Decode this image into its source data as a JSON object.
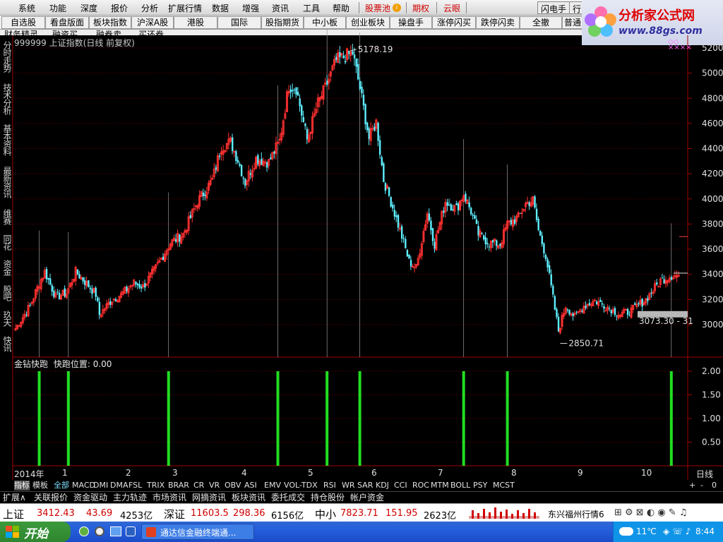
{
  "menu": {
    "items": [
      "系统",
      "功能",
      "深度",
      "报价",
      "分析",
      "扩展行情",
      "数据",
      "增强",
      "资讯",
      "工具",
      "帮助"
    ],
    "red_items": [
      "股票池",
      "期权",
      "云眼"
    ],
    "right_buttons": [
      "闪电手",
      "行"
    ]
  },
  "logo": {
    "title": "分析家公式网",
    "url": "www.88gs.com"
  },
  "toolbar": {
    "row1": [
      "自选股",
      "看盘版面",
      "板块指数",
      "沪深A股",
      "港股",
      "国际",
      "股指期货",
      "中小板",
      "创业板块",
      "操盘手",
      "涨停闪买",
      "跌停闪卖",
      "全撤",
      "普通"
    ],
    "row2": [
      "财务精灵",
      "融资买",
      "融券卖",
      "买还券"
    ]
  },
  "sidebar": {
    "tabs": [
      "分时走势",
      "技术分析",
      "基本资料",
      "最新资讯",
      "维赛",
      "同花",
      "资金",
      "股吧",
      "玖天",
      "快讯"
    ]
  },
  "chart": {
    "code": "999999",
    "name": "上证指数",
    "period": "(日线 前复权)",
    "high_label": "5178.19",
    "low_label": "2850.71",
    "last_label": "3073.30 - 31",
    "y_ticks": [
      "5200",
      "5000",
      "4800",
      "4600",
      "4400",
      "4200",
      "4000",
      "3800",
      "3600",
      "3400",
      "3200",
      "3000"
    ]
  },
  "indicator": {
    "title": "金钻快跑",
    "param_label": "快跑位置: 0.00",
    "y_ticks": [
      "2.00",
      "1.50",
      "1.00",
      "0.50"
    ],
    "colors": {
      "signal": "#22dd22"
    }
  },
  "chart_data": {
    "type": "candlestick",
    "series_name": "上证指数",
    "period": "daily",
    "x_range": [
      "2014-12",
      "2015-10"
    ],
    "ylim": [
      2800,
      5250
    ],
    "x_labels": [
      "2014年",
      "1",
      "2",
      "3",
      "4",
      "5",
      "6",
      "7",
      "8",
      "9",
      "10"
    ],
    "x_label_right": "日线",
    "colors": {
      "up": "#ff3030",
      "down": "#5ff0ff",
      "grid": "#7a0000"
    },
    "key_values": {
      "high": 5178.19,
      "low": 2850.71,
      "last": 3073.3
    },
    "price_path": [
      [
        0,
        2970
      ],
      [
        4,
        3060
      ],
      [
        8,
        3150
      ],
      [
        13,
        3330
      ],
      [
        16,
        3420
      ],
      [
        22,
        3220
      ],
      [
        28,
        3250
      ],
      [
        33,
        3420
      ],
      [
        40,
        3310
      ],
      [
        44,
        3240
      ],
      [
        46,
        3080
      ],
      [
        53,
        3200
      ],
      [
        58,
        3240
      ],
      [
        65,
        3330
      ],
      [
        70,
        3300
      ],
      [
        77,
        3450
      ],
      [
        85,
        3650
      ],
      [
        92,
        3720
      ],
      [
        100,
        3980
      ],
      [
        108,
        4150
      ],
      [
        113,
        4420
      ],
      [
        118,
        4450
      ],
      [
        122,
        4310
      ],
      [
        126,
        4130
      ],
      [
        132,
        4320
      ],
      [
        139,
        4290
      ],
      [
        145,
        4460
      ],
      [
        150,
        4900
      ],
      [
        154,
        4880
      ],
      [
        160,
        4470
      ],
      [
        166,
        4760
      ],
      [
        170,
        4880
      ],
      [
        176,
        5100
      ],
      [
        182,
        5140
      ],
      [
        185,
        5160
      ],
      [
        189,
        4880
      ],
      [
        194,
        4480
      ],
      [
        198,
        4610
      ],
      [
        202,
        4150
      ],
      [
        206,
        3980
      ],
      [
        212,
        3700
      ],
      [
        216,
        3500
      ],
      [
        220,
        3450
      ],
      [
        226,
        3890
      ],
      [
        230,
        3640
      ],
      [
        236,
        3980
      ],
      [
        242,
        3920
      ],
      [
        246,
        4040
      ],
      [
        250,
        3900
      ],
      [
        254,
        3720
      ],
      [
        260,
        3650
      ],
      [
        266,
        3640
      ],
      [
        270,
        3800
      ],
      [
        276,
        3850
      ],
      [
        280,
        3960
      ],
      [
        284,
        3990
      ],
      [
        287,
        3750
      ],
      [
        291,
        3550
      ],
      [
        295,
        3210
      ],
      [
        298,
        2950
      ],
      [
        302,
        3150
      ],
      [
        307,
        3060
      ],
      [
        312,
        3150
      ],
      [
        318,
        3190
      ],
      [
        325,
        3140
      ],
      [
        332,
        3080
      ],
      [
        338,
        3110
      ],
      [
        346,
        3200
      ],
      [
        354,
        3350
      ],
      [
        360,
        3390
      ],
      [
        364,
        3390
      ]
    ],
    "signal_series": {
      "name": "金钻快跑",
      "values_at_index": [
        [
          13,
          2
        ],
        [
          29,
          2
        ],
        [
          84,
          2
        ],
        [
          144,
          2
        ],
        [
          171,
          2
        ],
        [
          189,
          2
        ],
        [
          246,
          2
        ],
        [
          270,
          2
        ],
        [
          360,
          2
        ]
      ],
      "ylim": [
        0,
        2.2
      ]
    }
  },
  "ind_tabs": [
    "指标",
    "模板",
    "全部",
    "MACD",
    "DMI",
    "DMA",
    "FSL",
    "TRIX",
    "BRAR",
    "CR",
    "VR",
    "OBV",
    "ASI",
    "EMV",
    "VOL-TDX",
    "RSI",
    "WR",
    "SAR",
    "KDJ",
    "CCI",
    "ROC",
    "MTM",
    "BOLL",
    "PSY",
    "MCST"
  ],
  "ind_tabs_right": [
    "+",
    "-",
    "0"
  ],
  "func_tabs": [
    "扩展∧",
    "关联报价",
    "资金驱动",
    "主力轨迹",
    "市场资讯",
    "网摘资讯",
    "板块资讯",
    "委托成交",
    "持仓股份",
    "帐户资金"
  ],
  "ticker": {
    "sh_name": "上证",
    "sh_val": "3412.43",
    "sh_chg": "43.69",
    "sh_amt": "4253亿",
    "sz_name": "深证",
    "sz_val": "11603.5",
    "sz_chg": "298.36",
    "sz_amt": "6156亿",
    "zx_name": "中小",
    "zx_val": "7823.71",
    "zx_chg": "151.95",
    "zx_amt": "2623亿",
    "source": "东兴福州行情6"
  },
  "taskbar": {
    "start": "开始",
    "task": "通达信金融终端通...",
    "weather": "11℃",
    "time": "8:44"
  }
}
